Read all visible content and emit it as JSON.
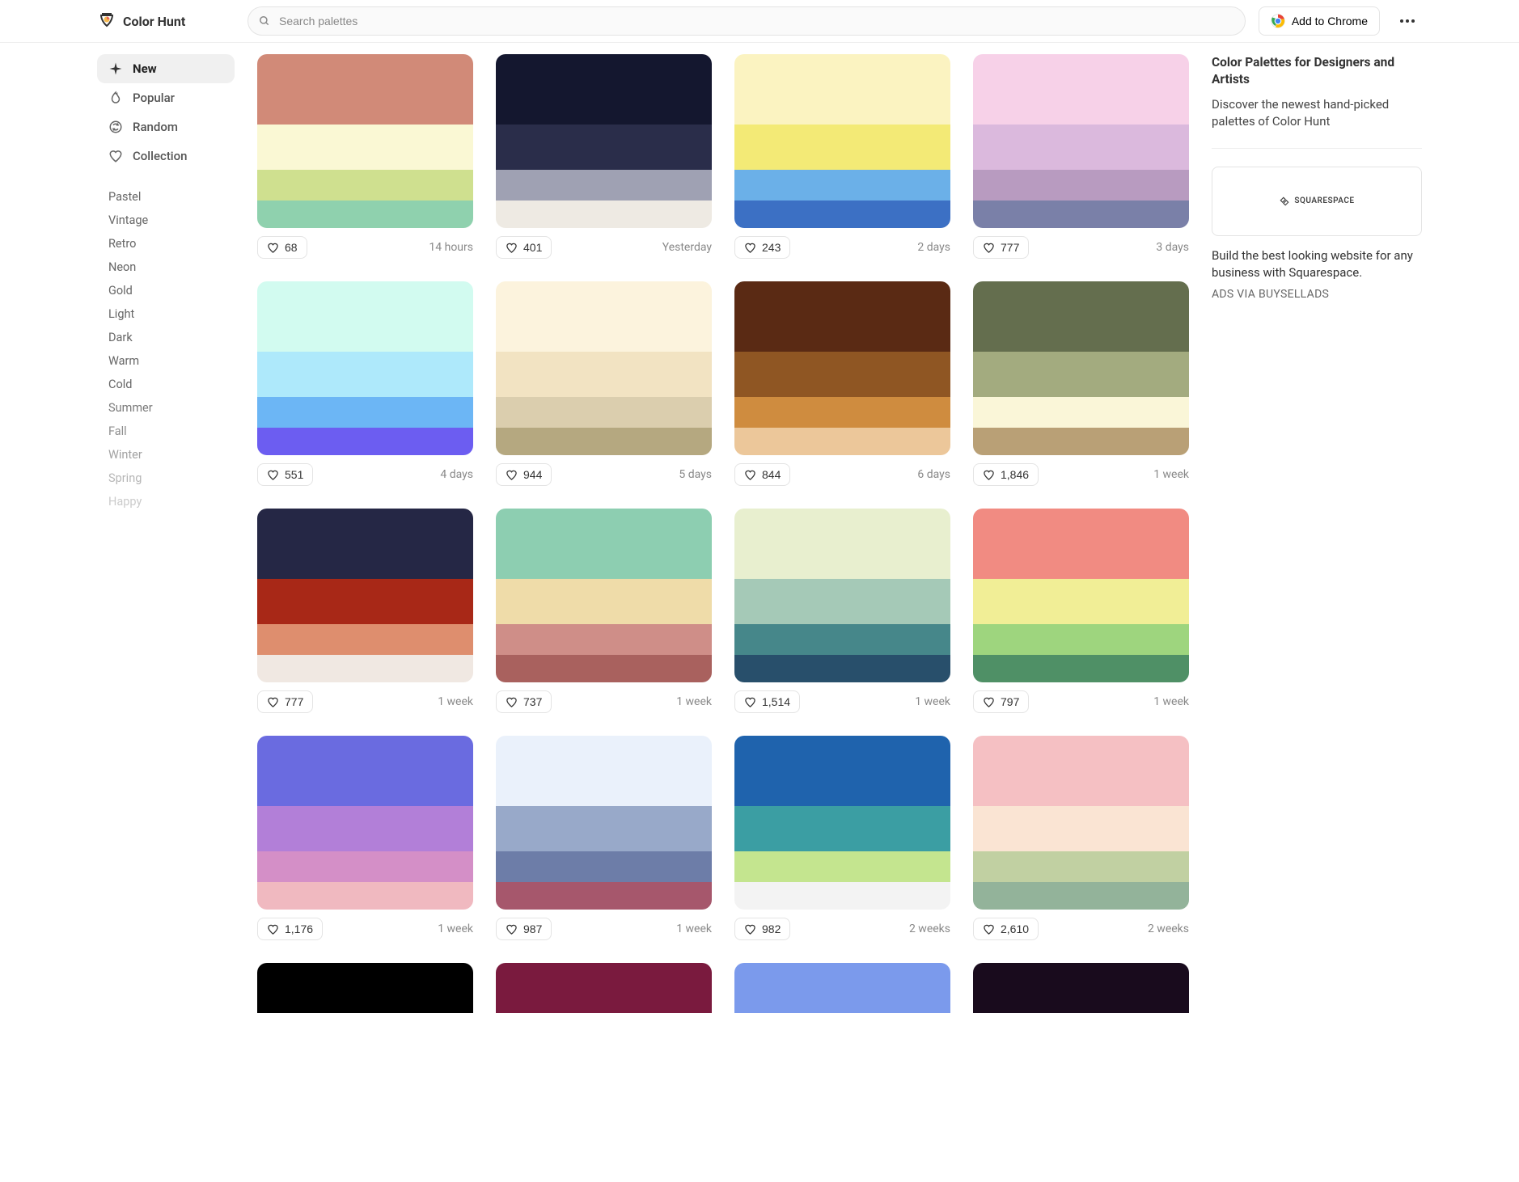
{
  "header": {
    "brand": "Color Hunt",
    "search_placeholder": "Search palettes",
    "chrome_label": "Add to Chrome"
  },
  "sidebar": {
    "main": [
      {
        "id": "new",
        "label": "New",
        "active": true,
        "icon": "sparkle"
      },
      {
        "id": "popular",
        "label": "Popular",
        "active": false,
        "icon": "flame"
      },
      {
        "id": "random",
        "label": "Random",
        "active": false,
        "icon": "shuffle"
      },
      {
        "id": "collection",
        "label": "Collection",
        "active": false,
        "icon": "heart"
      }
    ],
    "tags": [
      "Pastel",
      "Vintage",
      "Retro",
      "Neon",
      "Gold",
      "Light",
      "Dark",
      "Warm",
      "Cold",
      "Summer",
      "Fall",
      "Winter",
      "Spring",
      "Happy"
    ]
  },
  "palettes": [
    {
      "colors": [
        "#d18a78",
        "#faf8d4",
        "#cfe08f",
        "#8fd1ae"
      ],
      "likes": "68",
      "time": "14 hours"
    },
    {
      "colors": [
        "#14172f",
        "#2a2d4a",
        "#9fa1b3",
        "#eeeae3"
      ],
      "likes": "401",
      "time": "Yesterday"
    },
    {
      "colors": [
        "#fbf3c1",
        "#f3ea76",
        "#6bb0e8",
        "#3c70c4"
      ],
      "likes": "243",
      "time": "2 days"
    },
    {
      "colors": [
        "#f7d1e8",
        "#dbb9dd",
        "#b89bc0",
        "#7a80a8"
      ],
      "likes": "777",
      "time": "3 days"
    },
    {
      "colors": [
        "#d2fbf0",
        "#aee9fb",
        "#6cb6f5",
        "#6c5df1"
      ],
      "likes": "551",
      "time": "4 days"
    },
    {
      "colors": [
        "#fcf3dd",
        "#f2e3c2",
        "#dbceae",
        "#b5a880"
      ],
      "likes": "944",
      "time": "5 days"
    },
    {
      "colors": [
        "#5a2a14",
        "#8f5623",
        "#cf8c3f",
        "#ecc79a"
      ],
      "likes": "844",
      "time": "6 days"
    },
    {
      "colors": [
        "#646e4e",
        "#a3ab7f",
        "#faf6d8",
        "#b9a076"
      ],
      "likes": "1,846",
      "time": "1 week"
    },
    {
      "colors": [
        "#252745",
        "#a82817",
        "#de8e6e",
        "#f0e8e2"
      ],
      "likes": "777",
      "time": "1 week"
    },
    {
      "colors": [
        "#8dceb1",
        "#efdca9",
        "#cf8e88",
        "#a9615e"
      ],
      "likes": "737",
      "time": "1 week"
    },
    {
      "colors": [
        "#e8efcf",
        "#a5c9b7",
        "#46878a",
        "#284f6b"
      ],
      "likes": "1,514",
      "time": "1 week"
    },
    {
      "colors": [
        "#f18b82",
        "#f1ee96",
        "#9ed57e",
        "#4f9066"
      ],
      "likes": "797",
      "time": "1 week"
    },
    {
      "colors": [
        "#6a6be0",
        "#b27fd8",
        "#d48fc7",
        "#f0b9c0"
      ],
      "likes": "1,176",
      "time": "1 week"
    },
    {
      "colors": [
        "#eaf1fb",
        "#98a9c9",
        "#6d7da8",
        "#a6576c"
      ],
      "likes": "987",
      "time": "1 week"
    },
    {
      "colors": [
        "#1f63ad",
        "#3b9ea3",
        "#c4e58f",
        "#f3f3f3"
      ],
      "likes": "982",
      "time": "2 weeks"
    },
    {
      "colors": [
        "#f5c0c3",
        "#fae4d3",
        "#c1d0a2",
        "#93b39a"
      ],
      "likes": "2,610",
      "time": "2 weeks"
    },
    {
      "colors": [
        "#000000"
      ],
      "likes": "",
      "time": "",
      "partial": true
    },
    {
      "colors": [
        "#7a1a3e"
      ],
      "likes": "",
      "time": "",
      "partial": true
    },
    {
      "colors": [
        "#7b9aec"
      ],
      "likes": "",
      "time": "",
      "partial": true
    },
    {
      "colors": [
        "#190b1d"
      ],
      "likes": "",
      "time": "",
      "partial": true
    }
  ],
  "rightcol": {
    "title": "Color Palettes for Designers and Artists",
    "subtitle": "Discover the newest hand-picked palettes of Color Hunt",
    "ad_logo": "SQUARESPACE",
    "ad_text": "Build the best looking website for any business with Squarespace.",
    "ad_via": "ADS VIA BUYSELLADS"
  }
}
